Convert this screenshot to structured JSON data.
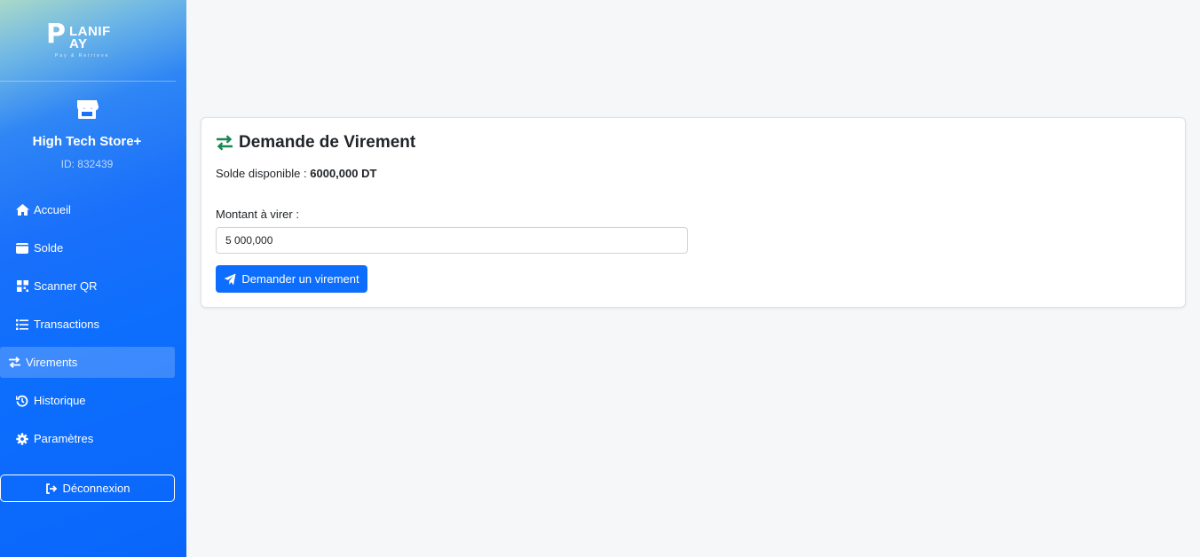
{
  "brand": {
    "logo_letter": "P",
    "logo_line1": "LANIF",
    "logo_line2": "AY",
    "logo_tagline": "Pay & Retrieve"
  },
  "store": {
    "name": "High Tech Store+",
    "id_label": "ID: 832439",
    "icon": "store-icon"
  },
  "sidebar": {
    "items": [
      {
        "label": "Accueil",
        "icon": "home-icon",
        "active": false
      },
      {
        "label": "Solde",
        "icon": "wallet-icon",
        "active": false
      },
      {
        "label": "Scanner QR",
        "icon": "qr-icon",
        "active": false
      },
      {
        "label": "Transactions",
        "icon": "list-icon",
        "active": false
      },
      {
        "label": "Virements",
        "icon": "transfer-icon",
        "active": true
      },
      {
        "label": "Historique",
        "icon": "history-icon",
        "active": false
      },
      {
        "label": "Paramètres",
        "icon": "gear-icon",
        "active": false
      }
    ],
    "logout_label": "Déconnexion"
  },
  "main": {
    "title": "Demande de Virement",
    "balance_label": "Solde disponible :",
    "balance_value": "6000,000 DT",
    "amount_label": "Montant à virer :",
    "amount_value": "5 000,000",
    "submit_label": "Demander un virement"
  },
  "colors": {
    "primary": "#0d6efd",
    "title_icon": "#198754",
    "sidebar_active": "rgba(255,255,255,0.2)"
  }
}
